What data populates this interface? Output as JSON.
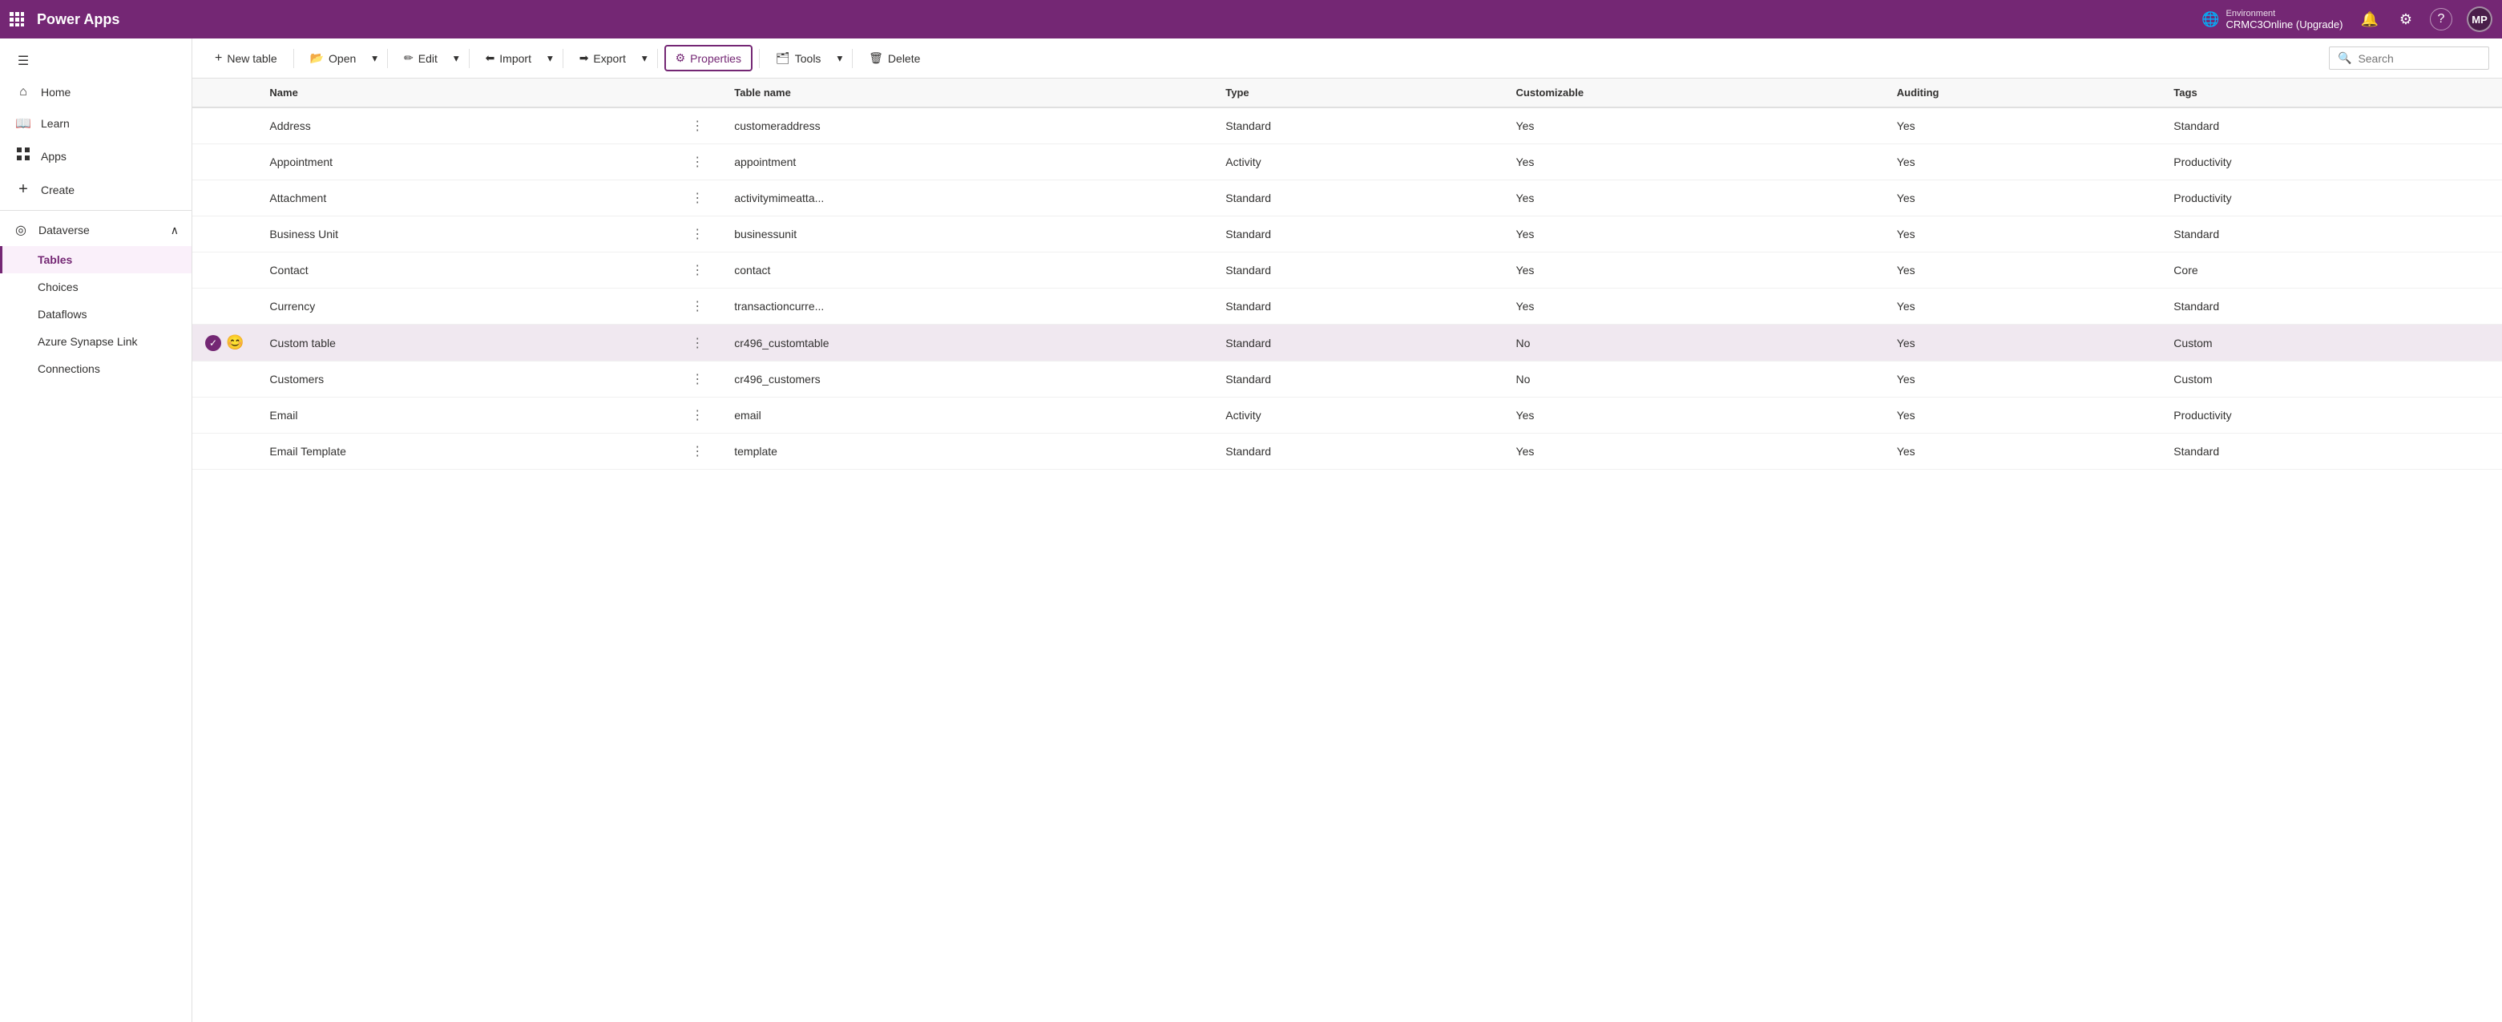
{
  "app": {
    "name": "Power Apps",
    "grid_icon": "⊞"
  },
  "topbar": {
    "env_label": "Environment",
    "env_name": "CRMC3Online (Upgrade)",
    "globe_icon": "🌐",
    "bell_icon": "🔔",
    "settings_icon": "⚙",
    "help_icon": "?",
    "avatar_initials": "MP"
  },
  "sidebar": {
    "menu_icon": "☰",
    "items": [
      {
        "id": "home",
        "label": "Home",
        "icon": "⌂"
      },
      {
        "id": "learn",
        "label": "Learn",
        "icon": "📖"
      },
      {
        "id": "apps",
        "label": "Apps",
        "icon": "⊞"
      },
      {
        "id": "create",
        "label": "Create",
        "icon": "+"
      }
    ],
    "dataverse_section": {
      "label": "Dataverse",
      "icon": "◎",
      "chevron": "∧",
      "sub_items": [
        {
          "id": "tables",
          "label": "Tables",
          "active": true
        },
        {
          "id": "choices",
          "label": "Choices",
          "active": false
        },
        {
          "id": "dataflows",
          "label": "Dataflows",
          "active": false
        },
        {
          "id": "azure-synapse",
          "label": "Azure Synapse Link",
          "active": false
        },
        {
          "id": "connections",
          "label": "Connections",
          "active": false
        }
      ]
    }
  },
  "toolbar": {
    "new_table_label": "New table",
    "open_label": "Open",
    "edit_label": "Edit",
    "import_label": "Import",
    "export_label": "Export",
    "properties_label": "Properties",
    "tools_label": "Tools",
    "delete_label": "Delete",
    "search_placeholder": "Search"
  },
  "table": {
    "columns": [
      "Name",
      "",
      "Table name",
      "Type",
      "Customizable",
      "Auditing",
      "Tags"
    ],
    "rows": [
      {
        "name": "Address",
        "dots": true,
        "table_name": "customeraddress",
        "type": "Standard",
        "customizable": "Yes",
        "auditing": "Yes",
        "tags": "Standard",
        "selected": false,
        "check": false,
        "emoji": null
      },
      {
        "name": "Appointment",
        "dots": true,
        "table_name": "appointment",
        "type": "Activity",
        "customizable": "Yes",
        "auditing": "Yes",
        "tags": "Productivity",
        "selected": false,
        "check": false,
        "emoji": null
      },
      {
        "name": "Attachment",
        "dots": true,
        "table_name": "activitymimeatta...",
        "type": "Standard",
        "customizable": "Yes",
        "auditing": "Yes",
        "tags": "Productivity",
        "selected": false,
        "check": false,
        "emoji": null
      },
      {
        "name": "Business Unit",
        "dots": true,
        "table_name": "businessunit",
        "type": "Standard",
        "customizable": "Yes",
        "auditing": "Yes",
        "tags": "Standard",
        "selected": false,
        "check": false,
        "emoji": null
      },
      {
        "name": "Contact",
        "dots": true,
        "table_name": "contact",
        "type": "Standard",
        "customizable": "Yes",
        "auditing": "Yes",
        "tags": "Core",
        "selected": false,
        "check": false,
        "emoji": null
      },
      {
        "name": "Currency",
        "dots": true,
        "table_name": "transactioncurre...",
        "type": "Standard",
        "customizable": "Yes",
        "auditing": "Yes",
        "tags": "Standard",
        "selected": false,
        "check": false,
        "emoji": null
      },
      {
        "name": "Custom table",
        "dots": true,
        "table_name": "cr496_customtable",
        "type": "Standard",
        "customizable": "No",
        "auditing": "Yes",
        "tags": "Custom",
        "selected": true,
        "check": true,
        "emoji": "😊"
      },
      {
        "name": "Customers",
        "dots": true,
        "table_name": "cr496_customers",
        "type": "Standard",
        "customizable": "No",
        "auditing": "Yes",
        "tags": "Custom",
        "selected": false,
        "check": false,
        "emoji": null
      },
      {
        "name": "Email",
        "dots": true,
        "table_name": "email",
        "type": "Activity",
        "customizable": "Yes",
        "auditing": "Yes",
        "tags": "Productivity",
        "selected": false,
        "check": false,
        "emoji": null
      },
      {
        "name": "Email Template",
        "dots": true,
        "table_name": "template",
        "type": "Standard",
        "customizable": "Yes",
        "auditing": "Yes",
        "tags": "Standard",
        "selected": false,
        "check": false,
        "emoji": null
      }
    ]
  }
}
